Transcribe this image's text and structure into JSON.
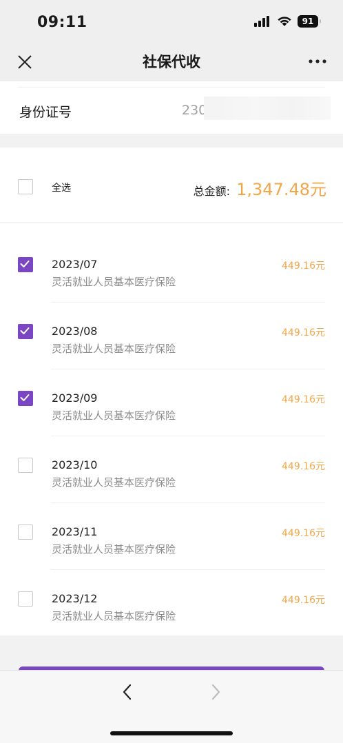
{
  "status_bar": {
    "time": "09:11",
    "battery": "91",
    "icons": [
      "signal-icon",
      "wifi-icon",
      "battery-icon"
    ]
  },
  "nav": {
    "title": "社保代收",
    "close_icon": "close-icon",
    "more_icon": "more-icon"
  },
  "id_section": {
    "label": "身份证号",
    "value": "230"
  },
  "summary": {
    "select_all_label": "全选",
    "total_label": "总金额:",
    "total_value": "1,347.48元"
  },
  "items": [
    {
      "period": "2023/07",
      "desc": "灵活就业人员基本医疗保险",
      "amount": "449.16元",
      "checked": true
    },
    {
      "period": "2023/08",
      "desc": "灵活就业人员基本医疗保险",
      "amount": "449.16元",
      "checked": true
    },
    {
      "period": "2023/09",
      "desc": "灵活就业人员基本医疗保险",
      "amount": "449.16元",
      "checked": true
    },
    {
      "period": "2023/10",
      "desc": "灵活就业人员基本医疗保险",
      "amount": "449.16元",
      "checked": false
    },
    {
      "period": "2023/11",
      "desc": "灵活就业人员基本医疗保险",
      "amount": "449.16元",
      "checked": false
    },
    {
      "period": "2023/12",
      "desc": "灵活就业人员基本医疗保险",
      "amount": "449.16元",
      "checked": false
    }
  ],
  "colors": {
    "accent": "#7b46c4",
    "amount": "#f3a647",
    "background": "#f2f2f2"
  },
  "bottom_bar": {
    "back_icon": "chevron-left-icon",
    "forward_icon": "chevron-right-icon"
  }
}
